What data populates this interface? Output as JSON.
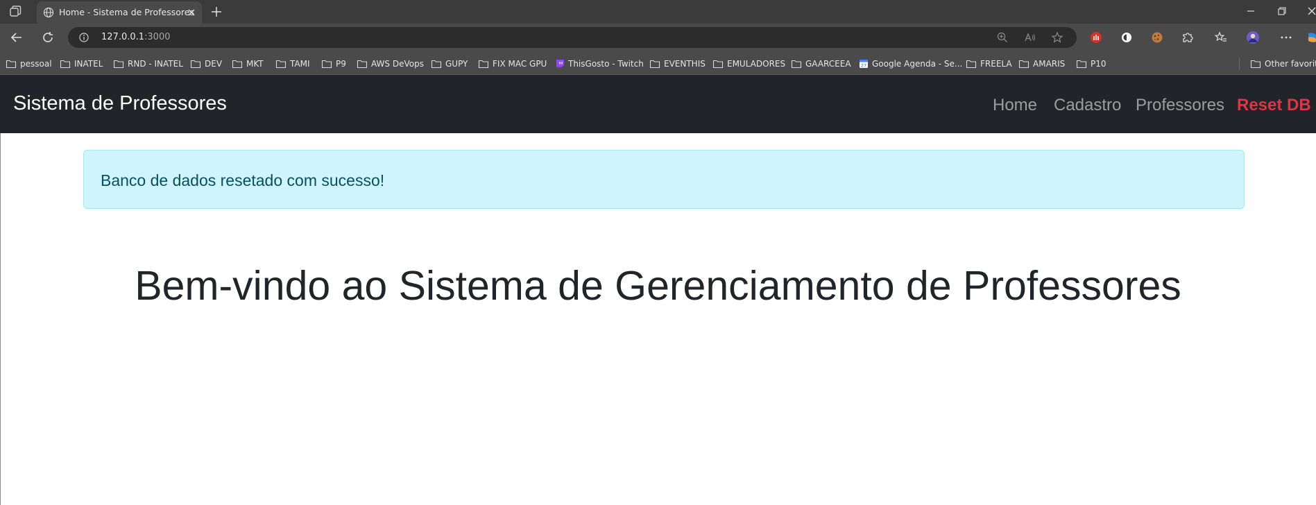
{
  "browser": {
    "tab": {
      "title": "Home - Sistema de Professores"
    },
    "address": {
      "host": "127.0.0.1",
      "port": ":3000"
    },
    "bookmarks": [
      "pessoal",
      "INATEL",
      "RND - INATEL",
      "DEV",
      "MKT",
      "TAMI",
      "P9",
      "AWS DeVops",
      "GUPY",
      "FIX MAC GPU",
      "ThisGosto - Twitch",
      "EVENTHIS",
      "EMULADORES",
      "GAARCEEA",
      "Google Agenda - Se...",
      "FREELA",
      "AMARIS",
      "P10"
    ],
    "other_favorites": "Other favorites"
  },
  "navbar": {
    "brand": "Sistema de Professores",
    "links": [
      "Home",
      "Cadastro",
      "Professores",
      "Reset DB"
    ],
    "reset_color": "#dc3545",
    "background": "#212529"
  },
  "alert": {
    "message": "Banco de dados resetado com sucesso!",
    "background": "#cff4fc",
    "text_color": "#055160"
  },
  "main": {
    "headline": "Bem-vindo ao Sistema de Gerenciamento de Professores"
  },
  "icons": {
    "tab_actions": "tab-actions-icon",
    "globe": "globe-icon",
    "close": "close-icon",
    "new_tab": "plus-icon",
    "back": "back-arrow-icon",
    "reload": "reload-icon",
    "info": "info-icon",
    "zoom": "zoom-icon",
    "read_aloud": "read-aloud-icon",
    "favorite": "star-icon",
    "folder": "folder-icon"
  }
}
